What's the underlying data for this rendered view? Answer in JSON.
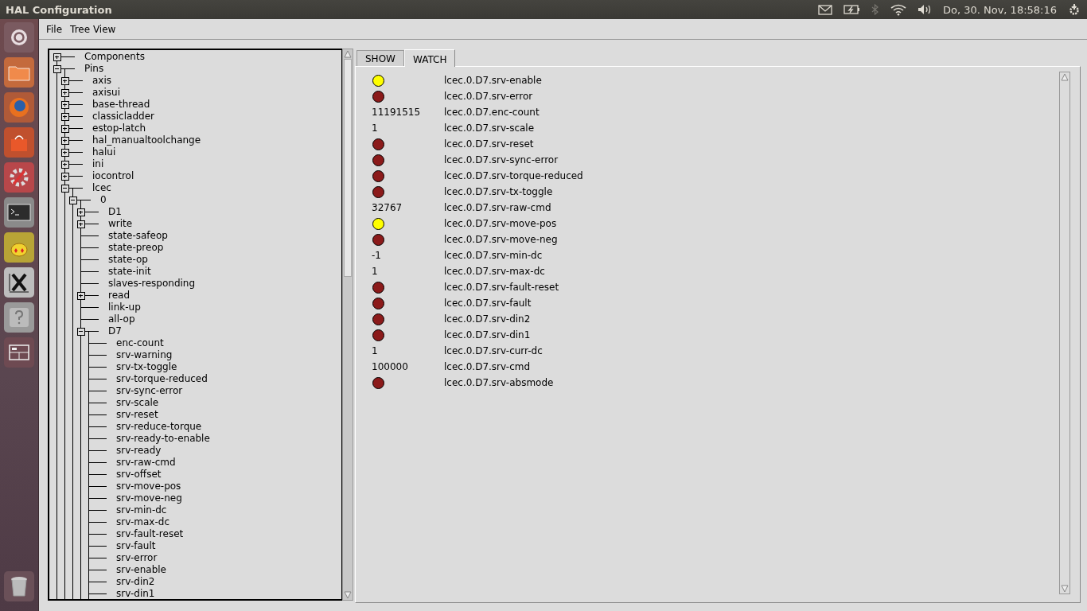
{
  "top_bar": {
    "title": "HAL Configuration",
    "clock": "Do, 30. Nov, 18:58:16"
  },
  "menu": [
    "File",
    "Tree View"
  ],
  "tree": [
    {
      "label": "Components",
      "expanded": false
    },
    {
      "label": "Pins",
      "expanded": true,
      "children": [
        {
          "label": "axis",
          "expanded": false
        },
        {
          "label": "axisui",
          "expanded": false
        },
        {
          "label": "base-thread",
          "expanded": false
        },
        {
          "label": "classicladder",
          "expanded": false
        },
        {
          "label": "estop-latch",
          "expanded": false
        },
        {
          "label": "hal_manualtoolchange",
          "expanded": false
        },
        {
          "label": "halui",
          "expanded": false
        },
        {
          "label": "ini",
          "expanded": false
        },
        {
          "label": "iocontrol",
          "expanded": false
        },
        {
          "label": "lcec",
          "expanded": true,
          "children": [
            {
              "label": "0",
              "expanded": true,
              "children": [
                {
                  "label": "D1",
                  "expanded": false
                },
                {
                  "label": "write",
                  "expanded": false
                },
                {
                  "label": "state-safeop"
                },
                {
                  "label": "state-preop"
                },
                {
                  "label": "state-op"
                },
                {
                  "label": "state-init"
                },
                {
                  "label": "slaves-responding"
                },
                {
                  "label": "read",
                  "expanded": false
                },
                {
                  "label": "link-up"
                },
                {
                  "label": "all-op"
                },
                {
                  "label": "D7",
                  "expanded": true,
                  "children": [
                    {
                      "label": "enc-count"
                    },
                    {
                      "label": "srv-warning"
                    },
                    {
                      "label": "srv-tx-toggle"
                    },
                    {
                      "label": "srv-torque-reduced"
                    },
                    {
                      "label": "srv-sync-error"
                    },
                    {
                      "label": "srv-scale"
                    },
                    {
                      "label": "srv-reset"
                    },
                    {
                      "label": "srv-reduce-torque"
                    },
                    {
                      "label": "srv-ready-to-enable"
                    },
                    {
                      "label": "srv-ready"
                    },
                    {
                      "label": "srv-raw-cmd"
                    },
                    {
                      "label": "srv-offset"
                    },
                    {
                      "label": "srv-move-pos"
                    },
                    {
                      "label": "srv-move-neg"
                    },
                    {
                      "label": "srv-min-dc"
                    },
                    {
                      "label": "srv-max-dc"
                    },
                    {
                      "label": "srv-fault-reset"
                    },
                    {
                      "label": "srv-fault"
                    },
                    {
                      "label": "srv-error"
                    },
                    {
                      "label": "srv-enable"
                    },
                    {
                      "label": "srv-din2"
                    },
                    {
                      "label": "srv-din1"
                    }
                  ]
                }
              ]
            }
          ]
        }
      ]
    }
  ],
  "tabs": [
    {
      "label": "SHOW",
      "selected": false
    },
    {
      "label": "WATCH",
      "selected": true
    }
  ],
  "watch": [
    {
      "kind": "bit",
      "on": true,
      "name": "lcec.0.D7.srv-enable"
    },
    {
      "kind": "bit",
      "on": false,
      "name": "lcec.0.D7.srv-error"
    },
    {
      "kind": "value",
      "value": "11191515",
      "name": "lcec.0.D7.enc-count"
    },
    {
      "kind": "value",
      "value": "1",
      "name": "lcec.0.D7.srv-scale"
    },
    {
      "kind": "bit",
      "on": false,
      "name": "lcec.0.D7.srv-reset"
    },
    {
      "kind": "bit",
      "on": false,
      "name": "lcec.0.D7.srv-sync-error"
    },
    {
      "kind": "bit",
      "on": false,
      "name": "lcec.0.D7.srv-torque-reduced"
    },
    {
      "kind": "bit",
      "on": false,
      "name": "lcec.0.D7.srv-tx-toggle"
    },
    {
      "kind": "value",
      "value": "32767",
      "name": "lcec.0.D7.srv-raw-cmd"
    },
    {
      "kind": "bit",
      "on": true,
      "name": "lcec.0.D7.srv-move-pos"
    },
    {
      "kind": "bit",
      "on": false,
      "name": "lcec.0.D7.srv-move-neg"
    },
    {
      "kind": "value",
      "value": "-1",
      "name": "lcec.0.D7.srv-min-dc"
    },
    {
      "kind": "value",
      "value": "1",
      "name": "lcec.0.D7.srv-max-dc"
    },
    {
      "kind": "bit",
      "on": false,
      "name": "lcec.0.D7.srv-fault-reset"
    },
    {
      "kind": "bit",
      "on": false,
      "name": "lcec.0.D7.srv-fault"
    },
    {
      "kind": "bit",
      "on": false,
      "name": "lcec.0.D7.srv-din2"
    },
    {
      "kind": "bit",
      "on": false,
      "name": "lcec.0.D7.srv-din1"
    },
    {
      "kind": "value",
      "value": "1",
      "name": "lcec.0.D7.srv-curr-dc"
    },
    {
      "kind": "value",
      "value": "100000",
      "name": "lcec.0.D7.srv-cmd"
    },
    {
      "kind": "bit",
      "on": false,
      "name": "lcec.0.D7.srv-absmode"
    }
  ]
}
